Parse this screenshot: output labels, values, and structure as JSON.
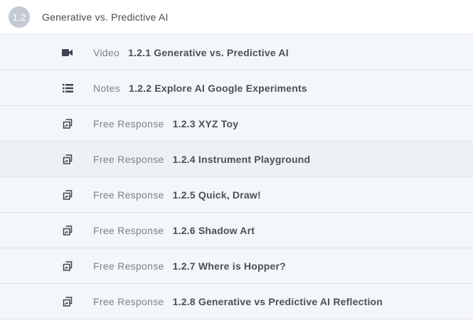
{
  "section": {
    "number": "1.2",
    "title": "Generative vs. Predictive AI"
  },
  "items": [
    {
      "type": "Video",
      "icon": "video-camera-icon",
      "title": "1.2.1 Generative vs. Predictive AI"
    },
    {
      "type": "Notes",
      "icon": "list-icon",
      "title": "1.2.2 Explore AI Google Experiments"
    },
    {
      "type": "Free Response",
      "icon": "free-response-icon",
      "title": "1.2.3 XYZ Toy"
    },
    {
      "type": "Free Response",
      "icon": "free-response-icon",
      "title": "1.2.4 Instrument Playground"
    },
    {
      "type": "Free Response",
      "icon": "free-response-icon",
      "title": "1.2.5 Quick, Draw!"
    },
    {
      "type": "Free Response",
      "icon": "free-response-icon",
      "title": "1.2.6 Shadow Art"
    },
    {
      "type": "Free Response",
      "icon": "free-response-icon",
      "title": "1.2.7 Where is Hopper?"
    },
    {
      "type": "Free Response",
      "icon": "free-response-icon",
      "title": "1.2.8 Generative vs Predictive AI Reflection"
    }
  ],
  "colors": {
    "badge": "#c3cad2",
    "row_bg": "#f3f6fa",
    "row_hover_bg": "#eef1f4"
  }
}
